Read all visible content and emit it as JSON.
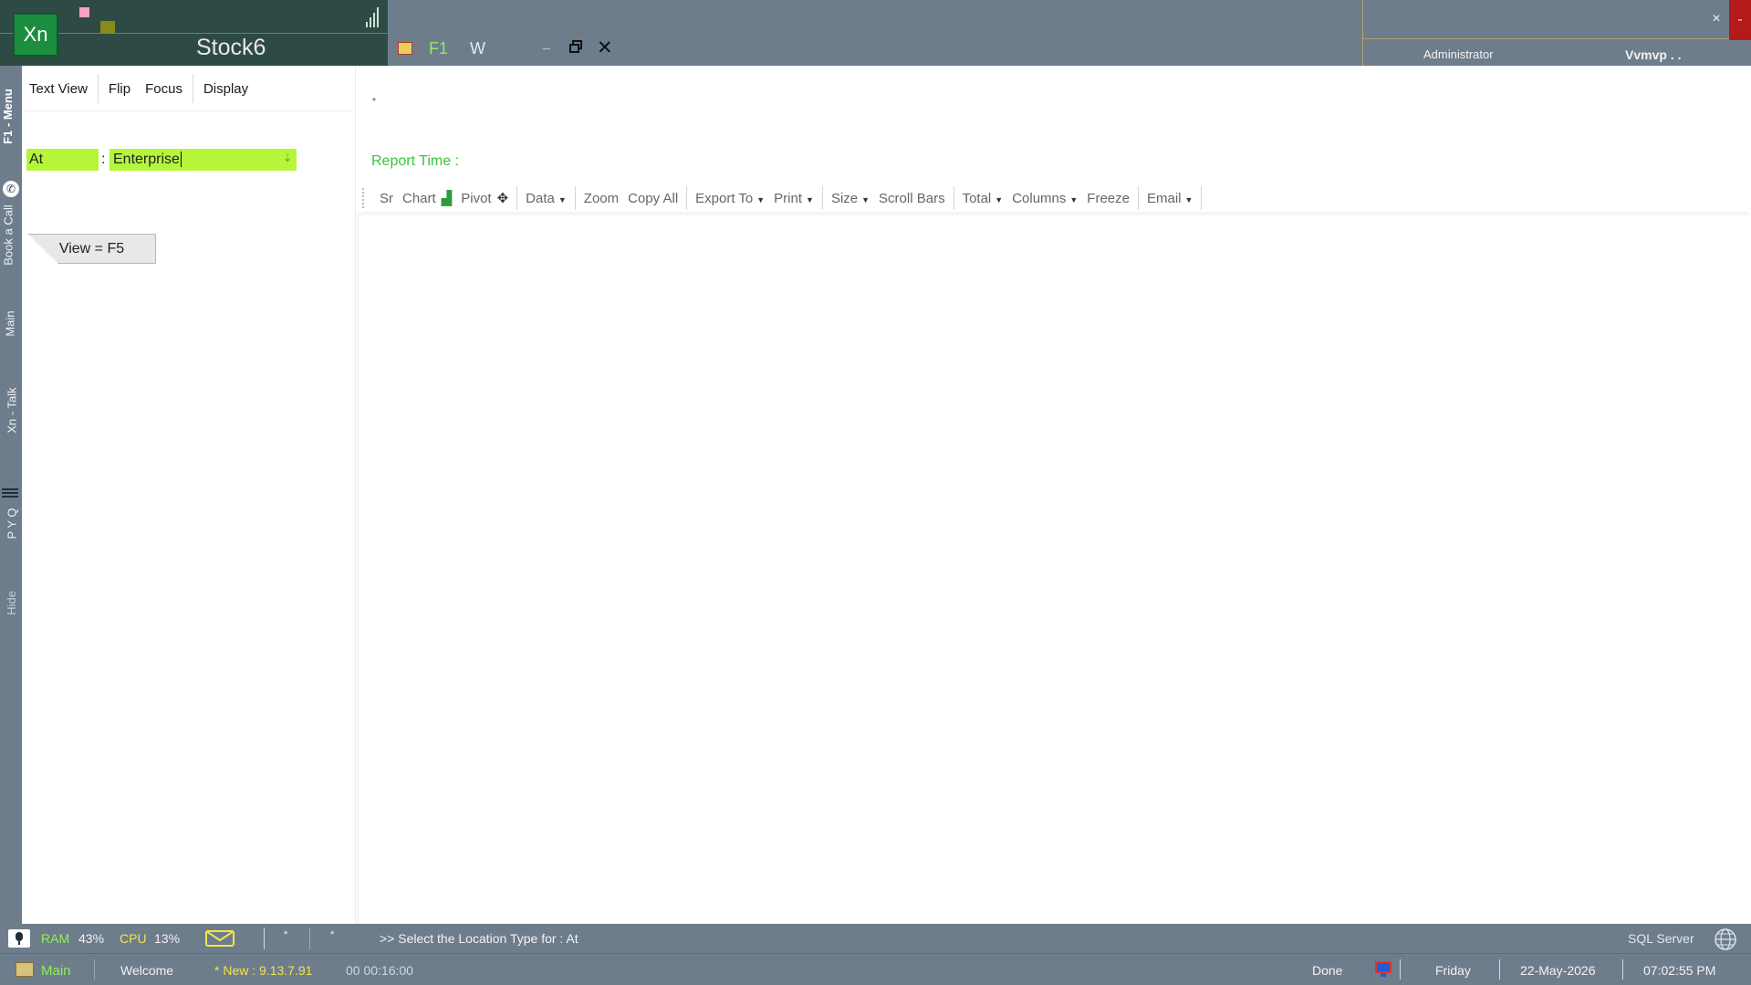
{
  "app": {
    "logo_text": "Xn",
    "title": "Stock6",
    "f1_label": "F1",
    "w_label": "W",
    "user_role": "Administrator",
    "user_name": "Vvmvp . .",
    "close_label": "×",
    "min_label": "-"
  },
  "side_tabs": [
    "F1 - Menu",
    "Book a Call",
    "Main",
    "Xn - Talk",
    "P Y Q",
    "Hide"
  ],
  "left_menu": [
    "Text View",
    "Flip",
    "Focus",
    "Display"
  ],
  "filter": {
    "label": "At",
    "separator": ":",
    "value": "Enterprise"
  },
  "view_button": "View = F5",
  "main": {
    "star": "*",
    "report_time_label": "Report Time :"
  },
  "toolbar": {
    "sr": "Sr",
    "chart": "Chart",
    "pivot": "Pivot",
    "data": "Data",
    "zoom": "Zoom",
    "copy_all": "Copy All",
    "export_to": "Export To",
    "print": "Print",
    "size": "Size",
    "scroll_bars": "Scroll Bars",
    "total": "Total",
    "columns": "Columns",
    "freeze": "Freeze",
    "email": "Email"
  },
  "status": {
    "ram_label": "RAM",
    "ram_value": "43%",
    "cpu_label": "CPU",
    "cpu_value": "13%",
    "star1": "*",
    "star2": "*",
    "message": ">>  Select the Location Type for : At",
    "db": "SQL Server",
    "main_label": "Main",
    "welcome": "Welcome",
    "new_version": "* New : 9.13.7.91",
    "timer": "00 00:16:00",
    "done": "Done",
    "day": "Friday",
    "date": "22-May-2026",
    "time": "07:02:55 PM"
  },
  "colors": {
    "chrome": "#6e7d8c",
    "brand": "#2e4a45",
    "accent_green": "#b5f53a",
    "report_green": "#3cc23c"
  }
}
